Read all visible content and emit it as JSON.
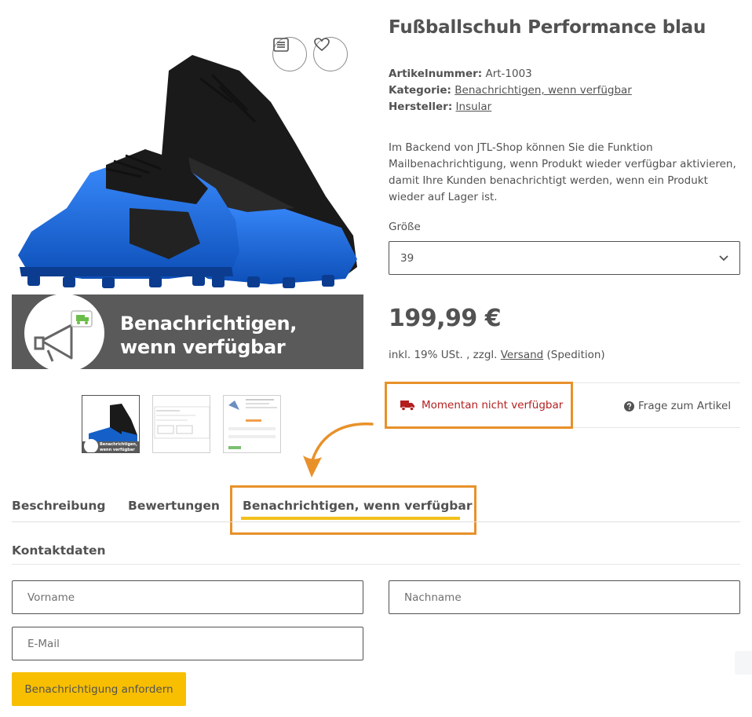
{
  "product": {
    "title": "Fußballschuh Performance blau",
    "sku_label": "Artikelnummer:",
    "sku_value": "Art-1003",
    "category_label": "Kategorie:",
    "category_value": "Benachrichtigen, wenn verfügbar",
    "manufacturer_label": "Hersteller:",
    "manufacturer_value": "Insular",
    "description": "Im Backend von JTL-Shop können Sie die Funktion Mailbenachrichtigung, wenn Produkt wieder verfügbar aktivieren, damit Ihre Kunden benachrichtigt werden, wenn ein Produkt wieder auf Lager ist.",
    "size_label": "Größe",
    "size_selected": "39",
    "price": "199,99 €",
    "tax_prefix": "inkl. 19% USt. , zzgl.",
    "shipping_link": "Versand",
    "tax_suffix": "(Spedition)",
    "stock_status": "Momentan nicht verfügbar",
    "question_link": "Frage zum Artikel"
  },
  "image": {
    "banner_line1": "Benachrichtigen,",
    "banner_line2": "wenn verfügbar",
    "compare_icon": "list-icon",
    "wishlist_icon": "heart-icon",
    "thumb1_line1": "Benachrichtigen,",
    "thumb1_line2": "wenn verfügbar"
  },
  "tabs": [
    {
      "label": "Beschreibung"
    },
    {
      "label": "Bewertungen"
    },
    {
      "label": "Benachrichtigen, wenn verfügbar"
    }
  ],
  "form": {
    "section_title": "Kontaktdaten",
    "firstname_placeholder": "Vorname",
    "lastname_placeholder": "Nachname",
    "email_placeholder": "E-Mail",
    "submit_label": "Benachrichtigung anfordern"
  },
  "colors": {
    "highlight_box": "#e8912a",
    "tab_underline": "#f3c01b",
    "button": "#f8bf00",
    "stock_red": "#b41e1e",
    "shoe_blue": "#1560c8"
  }
}
